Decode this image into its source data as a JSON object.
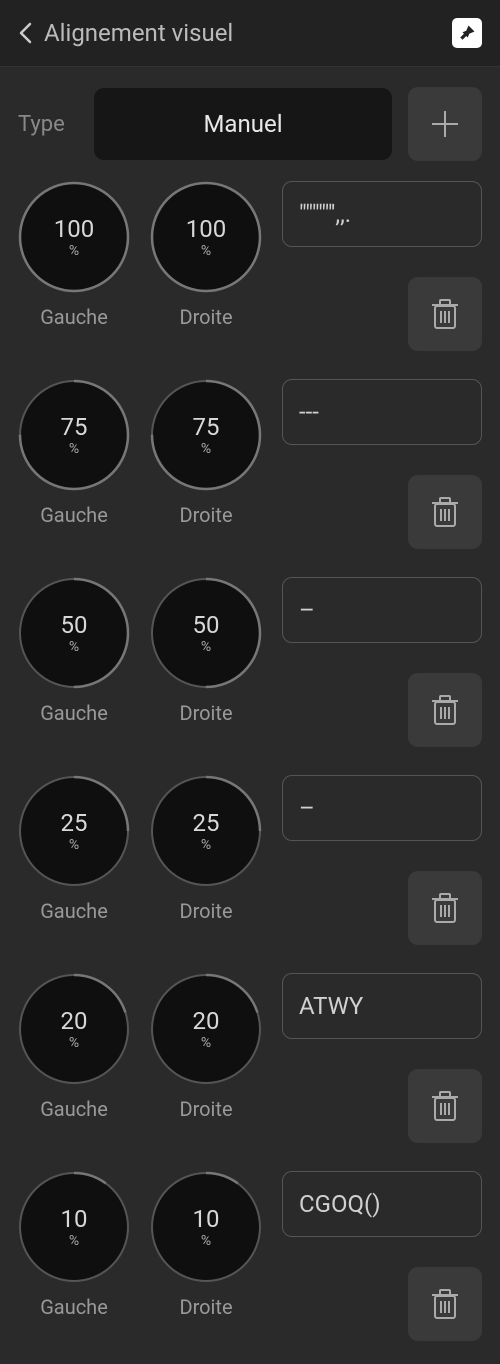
{
  "header": {
    "title": "Alignement visuel"
  },
  "type": {
    "label": "Type",
    "value": "Manuel"
  },
  "labels": {
    "left": "Gauche",
    "right": "Droite",
    "unit": "%"
  },
  "rows": [
    {
      "left": "100",
      "right": "100",
      "text": "\"\"\"\"\"',,.",
      "pctLeft": 100,
      "pctRight": 100
    },
    {
      "left": "75",
      "right": "75",
      "text": "---",
      "pctLeft": 75,
      "pctRight": 75
    },
    {
      "left": "50",
      "right": "50",
      "text": "–",
      "pctLeft": 50,
      "pctRight": 50
    },
    {
      "left": "25",
      "right": "25",
      "text": "–",
      "pctLeft": 25,
      "pctRight": 25
    },
    {
      "left": "20",
      "right": "20",
      "text": "ATWY",
      "pctLeft": 20,
      "pctRight": 20
    },
    {
      "left": "10",
      "right": "10",
      "text": "CGOQ()",
      "pctLeft": 10,
      "pctRight": 10
    }
  ]
}
